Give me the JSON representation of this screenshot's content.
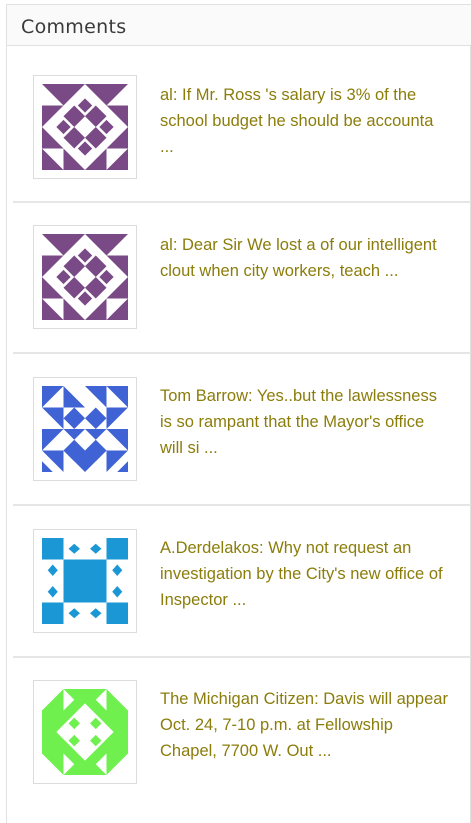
{
  "widget": {
    "title": "Comments",
    "comments": [
      {
        "text": "al: If Mr. Ross 's salary is 3% of the school budget he should be accounta ...",
        "avatar": "identicon-purple"
      },
      {
        "text": "al: Dear Sir We lost a of our intelligent clout when city workers, teach ...",
        "avatar": "identicon-purple"
      },
      {
        "text": "Tom Barrow: Yes..but the lawlessness is so rampant that the Mayor's office will si ...",
        "avatar": "identicon-blue"
      },
      {
        "text": "A.Derdelakos: Why not request an investigation by the City's new office of Inspector ...",
        "avatar": "identicon-cyan"
      },
      {
        "text": "The Michigan Citizen: Davis will appear Oct. 24, 7-10 p.m. at Fellowship Chapel, 7700 W. Out ...",
        "avatar": "identicon-green"
      }
    ]
  },
  "colors": {
    "link": "#8b7d0b",
    "purple": "#7a4a86",
    "blue": "#3f62d4",
    "cyan": "#1b97d6",
    "green": "#6ff04f"
  }
}
